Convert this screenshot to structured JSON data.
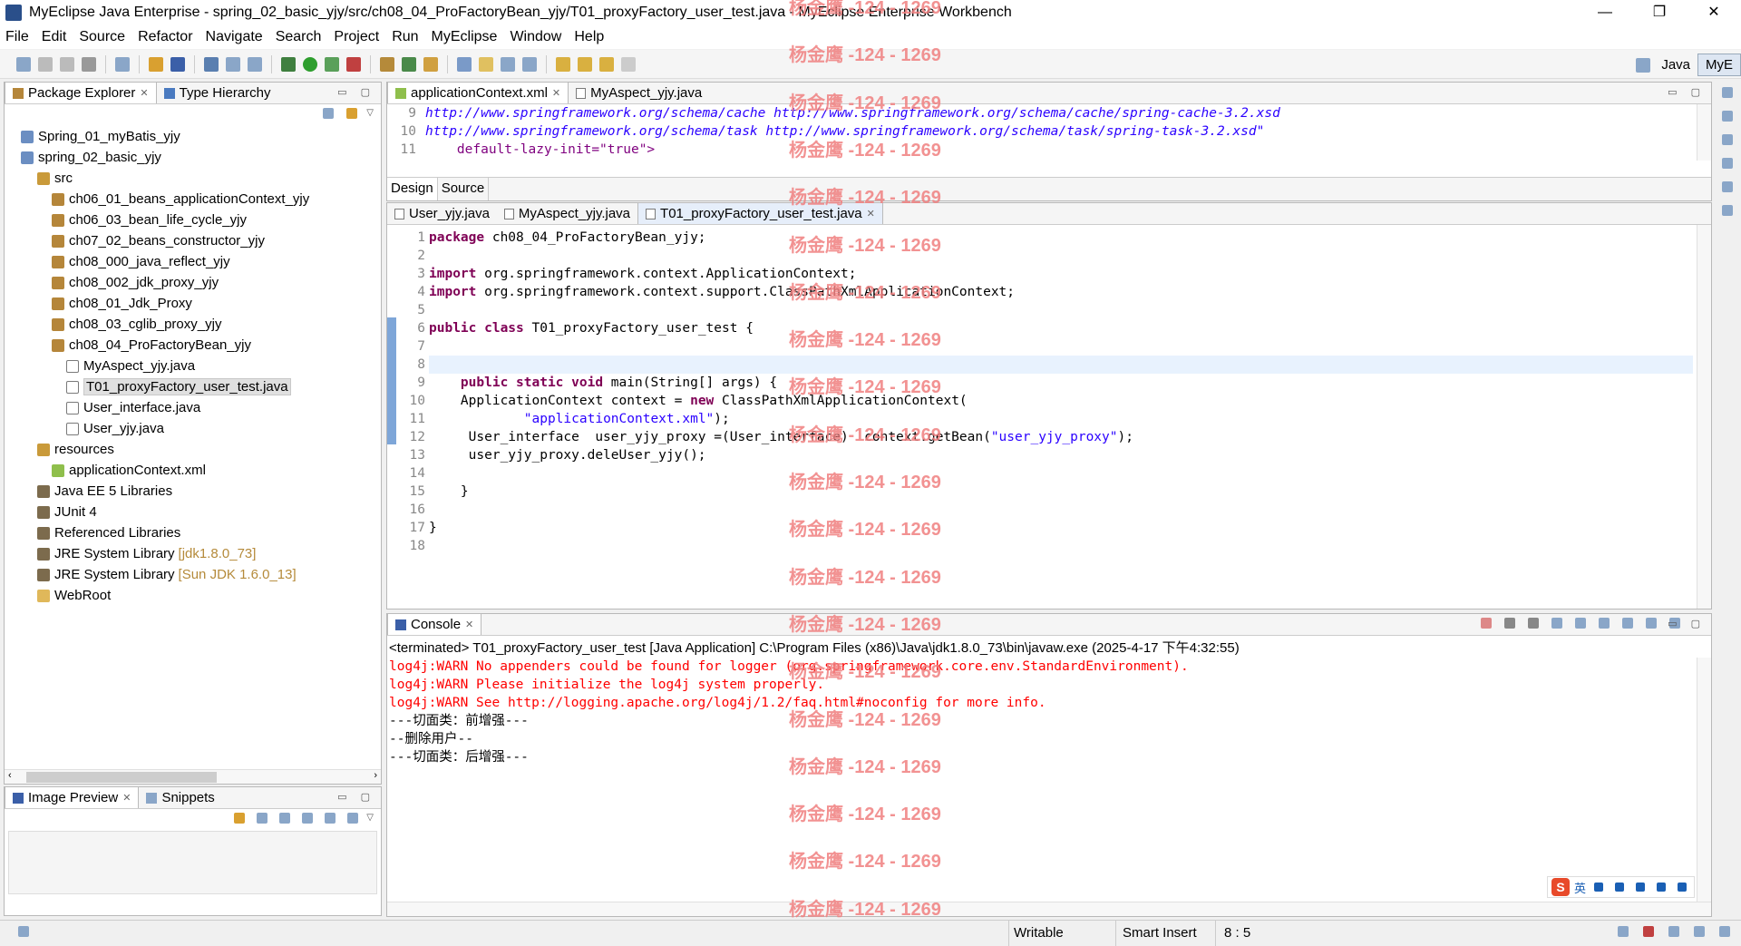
{
  "window": {
    "title": "MyEclipse Java Enterprise - spring_02_basic_yjy/src/ch08_04_ProFactoryBean_yjy/T01_proxyFactory_user_test.java - MyEclipse Enterprise Workbench",
    "minimize": "—",
    "restore": "❐",
    "close": "✕"
  },
  "menu": [
    "File",
    "Edit",
    "Source",
    "Refactor",
    "Navigate",
    "Search",
    "Project",
    "Run",
    "MyEclipse",
    "Window",
    "Help"
  ],
  "perspectives": {
    "java": "Java",
    "myeclipse": "MyE"
  },
  "package_explorer": {
    "tabs": [
      "Package Explorer",
      "Type Hierarchy"
    ],
    "tree": [
      {
        "label": "Spring_01_myBatis_yjy",
        "indent": 0,
        "icon": "project-icon"
      },
      {
        "label": "spring_02_basic_yjy",
        "indent": 0,
        "icon": "project-icon"
      },
      {
        "label": "src",
        "indent": 1,
        "icon": "source-folder-icon"
      },
      {
        "label": "ch06_01_beans_applicationContext_yjy",
        "indent": 2,
        "icon": "package-icon"
      },
      {
        "label": "ch06_03_bean_life_cycle_yjy",
        "indent": 2,
        "icon": "package-icon"
      },
      {
        "label": "ch07_02_beans_constructor_yjy",
        "indent": 2,
        "icon": "package-icon"
      },
      {
        "label": "ch08_000_java_reflect_yjy",
        "indent": 2,
        "icon": "package-icon"
      },
      {
        "label": "ch08_002_jdk_proxy_yjy",
        "indent": 2,
        "icon": "package-icon"
      },
      {
        "label": "ch08_01_Jdk_Proxy",
        "indent": 2,
        "icon": "package-icon"
      },
      {
        "label": "ch08_03_cglib_proxy_yjy",
        "indent": 2,
        "icon": "package-icon"
      },
      {
        "label": "ch08_04_ProFactoryBean_yjy",
        "indent": 2,
        "icon": "package-icon"
      },
      {
        "label": "MyAspect_yjy.java",
        "indent": 3,
        "icon": "java-file-icon"
      },
      {
        "label": "T01_proxyFactory_user_test.java",
        "indent": 3,
        "icon": "java-file-icon",
        "selected": true
      },
      {
        "label": "User_interface.java",
        "indent": 3,
        "icon": "java-file-icon"
      },
      {
        "label": "User_yjy.java",
        "indent": 3,
        "icon": "java-file-icon"
      },
      {
        "label": "resources",
        "indent": 1,
        "icon": "source-folder-icon"
      },
      {
        "label": "applicationContext.xml",
        "indent": 2,
        "icon": "xml-file-icon"
      },
      {
        "label": "Java EE 5 Libraries",
        "indent": 1,
        "icon": "library-icon"
      },
      {
        "label": "JUnit 4",
        "indent": 1,
        "icon": "library-icon"
      },
      {
        "label": "Referenced Libraries",
        "indent": 1,
        "icon": "library-icon"
      },
      {
        "label": "JRE System Library",
        "indent": 1,
        "icon": "library-icon",
        "suffix": "[jdk1.8.0_73]"
      },
      {
        "label": "JRE System Library",
        "indent": 1,
        "icon": "library-icon",
        "suffix": "[Sun JDK 1.6.0_13]"
      },
      {
        "label": "WebRoot",
        "indent": 1,
        "icon": "folder-icon"
      }
    ]
  },
  "image_preview": {
    "tabs": [
      "Image Preview",
      "Snippets"
    ]
  },
  "xml_editor": {
    "tabs": [
      "applicationContext.xml",
      "MyAspect_yjy.java"
    ],
    "lines": [
      {
        "no": "9",
        "text": "http://www.springframework.org/schema/cache http://www.springframework.org/schema/cache/spring-cache-3.2.xsd",
        "style": "url"
      },
      {
        "no": "10",
        "text": "http://www.springframework.org/schema/task http://www.springframework.org/schema/task/spring-task-3.2.xsd\"",
        "style": "url"
      },
      {
        "no": "11",
        "text": "    default-lazy-init=\"true\">",
        "style": "attr"
      }
    ],
    "bottom_tabs": [
      "Design",
      "Source"
    ]
  },
  "java_editor": {
    "tabs": [
      "User_yjy.java",
      "MyAspect_yjy.java",
      "T01_proxyFactory_user_test.java"
    ],
    "line_numbers": [
      "1",
      "2",
      "3",
      "4",
      "5",
      "6",
      "7",
      "8",
      "9",
      "10",
      "11",
      "12",
      "13",
      "14",
      "15",
      "16",
      "17",
      "18"
    ],
    "code": {
      "l1_kw": "package",
      "l1_rest": " ch08_04_ProFactoryBean_yjy;",
      "l3_kw": "import",
      "l3_rest": " org.springframework.context.ApplicationContext;",
      "l4_kw": "import",
      "l4_rest": " org.springframework.context.support.ClassPathXmlApplicationContext;",
      "l6_kw": "public class",
      "l6_rest": " T01_proxyFactory_user_test {",
      "l9_pre": "    ",
      "l9_kw": "public static void",
      "l9_rest": " main(String[] args) {",
      "l10_pre": "    ApplicationContext context = ",
      "l10_kw": "new",
      "l10_rest": " ClassPathXmlApplicationContext(",
      "l11_pre": "            ",
      "l11_str": "\"applicationContext.xml\"",
      "l11_rest": ");",
      "l12_pre": "     User_interface  user_yjy_proxy =(User_interface)  context.getBean(",
      "l12_str": "\"user_yjy_proxy\"",
      "l12_rest": ");",
      "l13": "     user_yjy_proxy.deleUser_yjy();",
      "l15": "    }",
      "l17": "}"
    }
  },
  "console": {
    "tab": "Console",
    "header": "<terminated> T01_proxyFactory_user_test [Java Application] C:\\Program Files (x86)\\Java\\jdk1.8.0_73\\bin\\javaw.exe (2025-4-17 下午4:32:55)",
    "lines": [
      {
        "text": "log4j:WARN No appenders could be found for logger (org.springframework.core.env.StandardEnvironment).",
        "color": "#ff0000"
      },
      {
        "text": "log4j:WARN Please initialize the log4j system properly.",
        "color": "#ff0000"
      },
      {
        "text": "log4j:WARN See http://logging.apache.org/log4j/1.2/faq.html#noconfig for more info.",
        "color": "#ff0000"
      },
      {
        "text": "---切面类：前增强---",
        "color": "#000000"
      },
      {
        "text": "--删除用户--",
        "color": "#000000"
      },
      {
        "text": "---切面类：后增强---",
        "color": "#000000"
      }
    ]
  },
  "status": {
    "writable": "Writable",
    "insert": "Smart Insert",
    "position": "8 : 5"
  },
  "ime": {
    "lang": "英"
  },
  "watermark": {
    "text": "杨金鹰 -124 - 1269",
    "color": "#f08080"
  }
}
